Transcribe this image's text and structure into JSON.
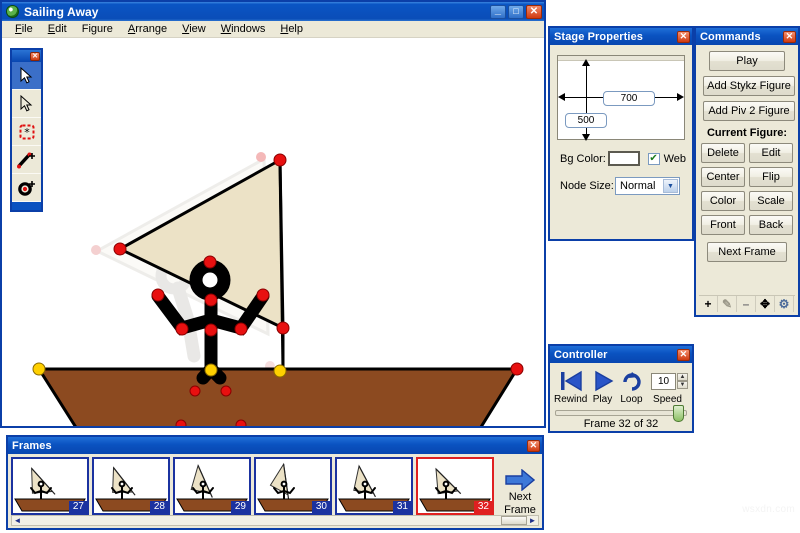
{
  "app": {
    "title": "Sailing Away",
    "icon": "app-globe-icon",
    "window_buttons": {
      "minimize": "_",
      "maximize": "□",
      "close": "✕"
    },
    "menus": [
      {
        "label": "File",
        "accel": "F"
      },
      {
        "label": "Edit",
        "accel": "E"
      },
      {
        "label": "Figure",
        "accel": "g"
      },
      {
        "label": "Arrange",
        "accel": "A"
      },
      {
        "label": "View",
        "accel": "V"
      },
      {
        "label": "Windows",
        "accel": "W"
      },
      {
        "label": "Help",
        "accel": "H"
      }
    ]
  },
  "toolbar": {
    "close_label": "✕",
    "tools": [
      {
        "name": "select-arrow-tool",
        "active": true
      },
      {
        "name": "pointer-arrow-tool",
        "active": false
      },
      {
        "name": "node-select-tool",
        "active": false
      },
      {
        "name": "add-segment-tool",
        "active": false
      },
      {
        "name": "add-node-tool",
        "active": false
      }
    ]
  },
  "stage_properties": {
    "title": "Stage Properties",
    "close_label": "✕",
    "width_value": "700",
    "height_value": "500",
    "bg_color_label": "Bg Color:",
    "bg_color_value": "#ffffff",
    "web_label": "Web",
    "web_checked": true,
    "web_check_glyph": "✔",
    "node_size_label": "Node Size:",
    "node_size_value": "Normal",
    "node_size_options": [
      "Normal"
    ],
    "dropdown_glyph": "▼"
  },
  "commands": {
    "title": "Commands",
    "close_label": "✕",
    "play_label": "Play",
    "add_stykz_label": "Add Stykz Figure",
    "add_piv2_label": "Add Piv 2 Figure",
    "current_figure_label": "Current Figure:",
    "figure_buttons": [
      [
        "Delete",
        "Edit"
      ],
      [
        "Center",
        "Flip"
      ],
      [
        "Color",
        "Scale"
      ],
      [
        "Front",
        "Back"
      ]
    ],
    "next_frame_label": "Next Frame",
    "mini_tools": [
      {
        "name": "add-icon",
        "glyph": "+"
      },
      {
        "name": "edit-pencil-icon",
        "glyph": "✎"
      },
      {
        "name": "remove-icon",
        "glyph": "–"
      },
      {
        "name": "move-icon",
        "glyph": "✥"
      },
      {
        "name": "settings-gear-icon",
        "glyph": "⚙"
      }
    ]
  },
  "controller": {
    "title": "Controller",
    "close_label": "✕",
    "rewind_label": "Rewind",
    "play_label": "Play",
    "loop_label": "Loop",
    "speed_label": "Speed",
    "speed_value": "10",
    "spin_up": "▲",
    "spin_down": "▼",
    "frame_status": "Frame 32 of 32",
    "slider_percent": 97
  },
  "frames": {
    "title": "Frames",
    "close_label": "✕",
    "thumbs": [
      {
        "number": "27",
        "selected": false,
        "sail_angle": -42,
        "arms": "up"
      },
      {
        "number": "28",
        "selected": false,
        "sail_angle": -38,
        "arms": "up"
      },
      {
        "number": "29",
        "selected": false,
        "sail_angle": -24,
        "arms": "up"
      },
      {
        "number": "30",
        "selected": false,
        "sail_angle": -8,
        "arms": "up"
      },
      {
        "number": "31",
        "selected": false,
        "sail_angle": -28,
        "arms": "up"
      },
      {
        "number": "32",
        "selected": true,
        "sail_angle": -45,
        "arms": "up"
      }
    ],
    "next_frame_label_line1": "Next",
    "next_frame_label_line2": "Frame",
    "scroll_left_glyph": "◄",
    "scroll_right_glyph": "►"
  },
  "canvas": {
    "name": "stage-canvas",
    "background": "#ffffff",
    "hull_color": "#8c4a20",
    "sail_color": "#ece2c6",
    "node_color": "#e81010",
    "root_node_color": "#ffd000",
    "onion_skin_color": "#d8d6d0"
  },
  "watermark": "wsxdn.com"
}
